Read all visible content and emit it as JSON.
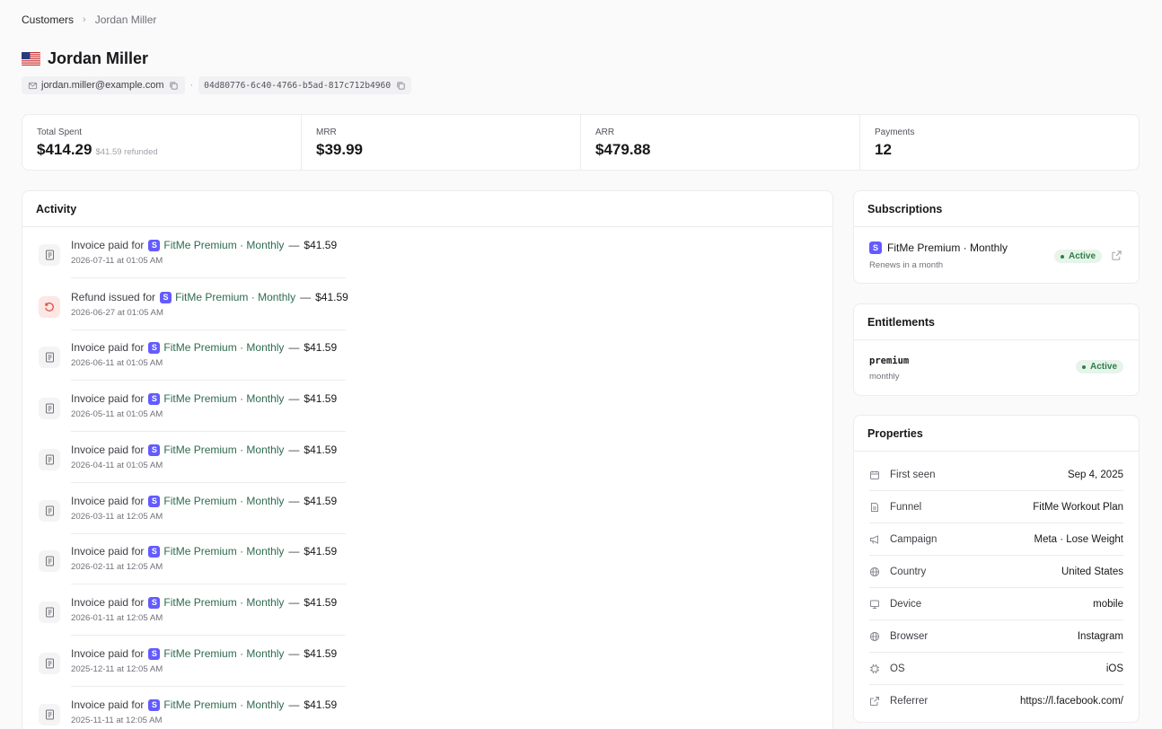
{
  "breadcrumb": {
    "parent": "Customers",
    "current": "Jordan Miller"
  },
  "customer": {
    "name": "Jordan Miller",
    "email": "jordan.miller@example.com",
    "id": "04d80776-6c40-4766-b5ad-817c712b4960",
    "country_flag": "us-flag-icon"
  },
  "stats": [
    {
      "label": "Total Spent",
      "value": "$414.29",
      "sub": "$41.59 refunded"
    },
    {
      "label": "MRR",
      "value": "$39.99",
      "sub": ""
    },
    {
      "label": "ARR",
      "value": "$479.88",
      "sub": ""
    },
    {
      "label": "Payments",
      "value": "12",
      "sub": ""
    }
  ],
  "activity": {
    "title": "Activity",
    "items": [
      {
        "type": "invoice",
        "text": "Invoice paid for",
        "plan": "FitMe Premium · Monthly",
        "amount": "$41.59",
        "time": "2026-07-11 at 01:05 AM"
      },
      {
        "type": "refund",
        "text": "Refund issued for",
        "plan": "FitMe Premium · Monthly",
        "amount": "$41.59",
        "time": "2026-06-27 at 01:05 AM"
      },
      {
        "type": "invoice",
        "text": "Invoice paid for",
        "plan": "FitMe Premium · Monthly",
        "amount": "$41.59",
        "time": "2026-06-11 at 01:05 AM"
      },
      {
        "type": "invoice",
        "text": "Invoice paid for",
        "plan": "FitMe Premium · Monthly",
        "amount": "$41.59",
        "time": "2026-05-11 at 01:05 AM"
      },
      {
        "type": "invoice",
        "text": "Invoice paid for",
        "plan": "FitMe Premium · Monthly",
        "amount": "$41.59",
        "time": "2026-04-11 at 01:05 AM"
      },
      {
        "type": "invoice",
        "text": "Invoice paid for",
        "plan": "FitMe Premium · Monthly",
        "amount": "$41.59",
        "time": "2026-03-11 at 12:05 AM"
      },
      {
        "type": "invoice",
        "text": "Invoice paid for",
        "plan": "FitMe Premium · Monthly",
        "amount": "$41.59",
        "time": "2026-02-11 at 12:05 AM"
      },
      {
        "type": "invoice",
        "text": "Invoice paid for",
        "plan": "FitMe Premium · Monthly",
        "amount": "$41.59",
        "time": "2026-01-11 at 12:05 AM"
      },
      {
        "type": "invoice",
        "text": "Invoice paid for",
        "plan": "FitMe Premium · Monthly",
        "amount": "$41.59",
        "time": "2025-12-11 at 12:05 AM"
      },
      {
        "type": "invoice",
        "text": "Invoice paid for",
        "plan": "FitMe Premium · Monthly",
        "amount": "$41.59",
        "time": "2025-11-11 at 12:05 AM"
      }
    ]
  },
  "subscriptions": {
    "title": "Subscriptions",
    "items": [
      {
        "plan": "FitMe Premium · Monthly",
        "meta": "Renews in a month",
        "status": "Active"
      }
    ]
  },
  "entitlements": {
    "title": "Entitlements",
    "items": [
      {
        "key": "premium",
        "meta": "monthly",
        "status": "Active"
      }
    ]
  },
  "properties": {
    "title": "Properties",
    "rows": [
      {
        "icon": "calendar-icon",
        "label": "First seen",
        "value": "Sep 4, 2025"
      },
      {
        "icon": "document-icon",
        "label": "Funnel",
        "value": "FitMe Workout Plan"
      },
      {
        "icon": "megaphone-icon",
        "label": "Campaign",
        "value": "Meta · Lose Weight"
      },
      {
        "icon": "globe-icon",
        "label": "Country",
        "value": "United States"
      },
      {
        "icon": "monitor-icon",
        "label": "Device",
        "value": "mobile"
      },
      {
        "icon": "globe-icon",
        "label": "Browser",
        "value": "Instagram"
      },
      {
        "icon": "chip-icon",
        "label": "OS",
        "value": "iOS"
      },
      {
        "icon": "external-link-icon",
        "label": "Referrer",
        "value": "https://l.facebook.com/"
      }
    ]
  },
  "colors": {
    "accent_plan": "#635bff",
    "plan_link": "#2f6b4f",
    "active_badge_bg": "#e7f4ea",
    "active_badge_text": "#2e7d4a",
    "refund_bg": "#fde7e4"
  }
}
